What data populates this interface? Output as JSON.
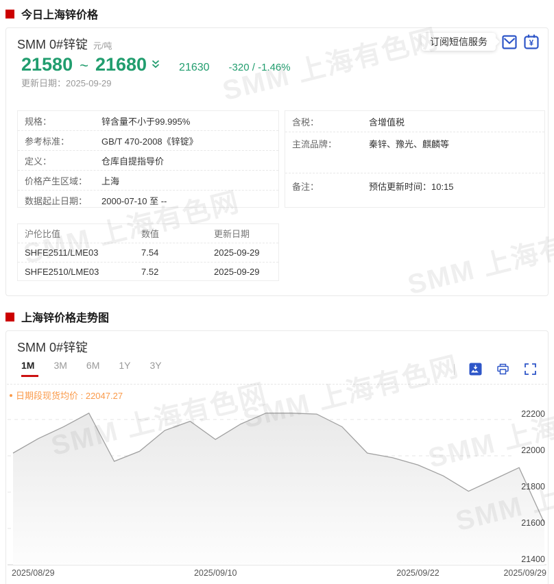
{
  "section1": {
    "title": "今日上海锌价格"
  },
  "section2": {
    "title": "上海锌价格走势图"
  },
  "colors": {
    "green": "#219d6e",
    "red": "#cc0000",
    "blue": "#2e56c8",
    "orange": "#fa9a4a"
  },
  "icons": {
    "trend": "double-chevron-down",
    "subscribe_mail": "envelope",
    "subscribe_price": "yuan-box",
    "toolbar": [
      "save-image",
      "printer",
      "fullscreen"
    ]
  },
  "card1": {
    "product": "SMM 0#锌锭",
    "unit": "元/吨",
    "price_low": "21580",
    "tilde": "~",
    "price_high": "21680",
    "avg": "21630",
    "change": "-320 / -1.46%",
    "update_label": "更新日期：",
    "update_date": "2025-09-29",
    "tooltip_text": "订阅短信服务",
    "spec_rows": [
      {
        "label": "规格：",
        "value": "锌含量不小于99.995%"
      },
      {
        "label": "参考标准：",
        "value": "GB/T 470-2008《锌锭》"
      },
      {
        "label": "定义：",
        "value": "仓库自提指导价"
      },
      {
        "label": "价格产生区域：",
        "value": "上海"
      },
      {
        "label": "数据起止日期：",
        "value": "2000-07-10 至 --"
      }
    ],
    "info_rows": [
      {
        "label": "含税：",
        "value": "含增值税"
      },
      {
        "label": "主流品牌：",
        "value": "秦锌、豫光、麒麟等"
      },
      {
        "label": "备注：",
        "value": "预估更新时间：10:15"
      }
    ],
    "ratio_table": {
      "headers": [
        "沪伦比值",
        "数值",
        "更新日期"
      ],
      "rows": [
        [
          "SHFE2511/LME03",
          "7.54",
          "2025-09-29"
        ],
        [
          "SHFE2510/LME03",
          "7.52",
          "2025-09-29"
        ]
      ]
    }
  },
  "card2": {
    "product": "SMM 0#锌锭",
    "tabs": [
      "1M",
      "3M",
      "6M",
      "1Y",
      "3Y"
    ],
    "active_tab": "1M",
    "legend_text": "日期段现货均价 : 22047.27"
  },
  "watermark": {
    "text": "SMM 上海有色网"
  },
  "chart_data": {
    "type": "area",
    "title": "SMM 0#锌锭 价格走势 (1M)",
    "series_name": "SMM 0#锌锭",
    "avg_label": "日期段现货均价",
    "avg_value": 22047.27,
    "x": [
      "2025/08/29",
      "2025/09/01",
      "2025/09/02",
      "2025/09/03",
      "2025/09/04",
      "2025/09/05",
      "2025/09/08",
      "2025/09/09",
      "2025/09/10",
      "2025/09/11",
      "2025/09/12",
      "2025/09/15",
      "2025/09/16",
      "2025/09/17",
      "2025/09/18",
      "2025/09/19",
      "2025/09/22",
      "2025/09/23",
      "2025/09/24",
      "2025/09/25",
      "2025/09/26",
      "2025/09/29"
    ],
    "values": [
      22015,
      22095,
      22160,
      22235,
      21970,
      22025,
      22140,
      22190,
      22090,
      22175,
      22235,
      22235,
      22230,
      22160,
      22015,
      21990,
      21950,
      21890,
      21805,
      21870,
      21935,
      21630
    ],
    "ylim": [
      21400,
      22300
    ],
    "yticks": [
      22200,
      22000,
      21800,
      21600,
      21400
    ],
    "x_tick_labels": [
      "2025/08/29",
      "2025/09/10",
      "2025/09/22",
      "2025/09/29"
    ],
    "x_tick_indices": [
      0,
      8,
      16,
      21
    ],
    "grid": "dashed-horizontal",
    "legend_position": "top-left",
    "line_color": "#a0a0a0",
    "fill_top": "#e9e9e9",
    "fill_bottom": "#fdfdfd"
  }
}
